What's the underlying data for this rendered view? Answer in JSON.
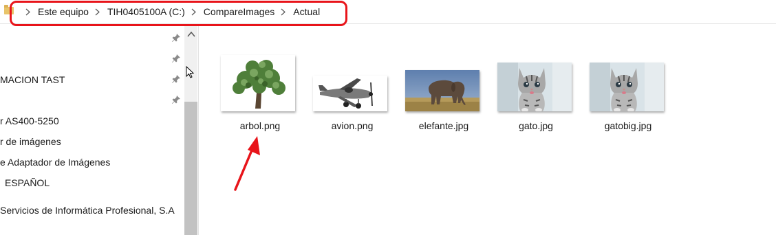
{
  "breadcrumb": {
    "items": [
      "Este equipo",
      "TIH0405100A (C:)",
      "CompareImages",
      "Actual"
    ]
  },
  "nav": {
    "items": [
      "MACION TAST",
      "r AS400-5250",
      "r de imágenes",
      "e Adaptador de Imágenes",
      "ESPAÑOL",
      "Servicios de Informática Profesional, S.A"
    ]
  },
  "files": [
    {
      "name": "arbol.png",
      "icon": "tree-image"
    },
    {
      "name": "avion.png",
      "icon": "airplane-image"
    },
    {
      "name": "elefante.jpg",
      "icon": "elephant-image"
    },
    {
      "name": "gato.jpg",
      "icon": "kitten-image"
    },
    {
      "name": "gatobig.jpg",
      "icon": "kitten-image"
    }
  ],
  "colors": {
    "highlight": "#e8141a",
    "annotation_arrow": "#e8141a"
  }
}
